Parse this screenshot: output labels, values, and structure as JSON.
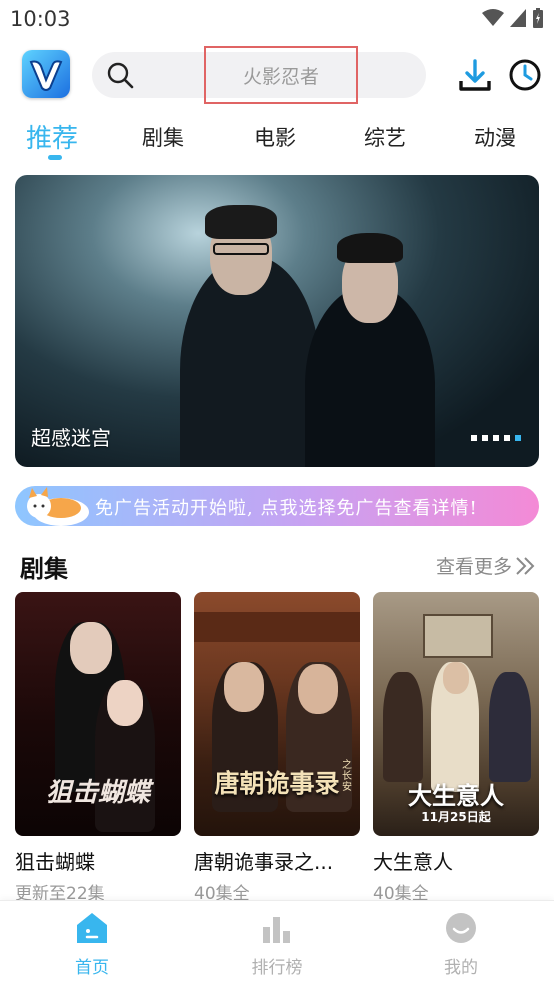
{
  "status_bar": {
    "time": "10:03"
  },
  "header": {
    "logo_letter": "V",
    "search_placeholder": "火影忍者"
  },
  "tabs": [
    {
      "label": "推荐",
      "active": true
    },
    {
      "label": "剧集",
      "active": false
    },
    {
      "label": "电影",
      "active": false
    },
    {
      "label": "综艺",
      "active": false
    },
    {
      "label": "动漫",
      "active": false
    }
  ],
  "banner": {
    "title": "超感迷宫",
    "dot_count": 5,
    "active_dot": 4
  },
  "promo": {
    "text": "免广告活动开始啦, 点我选择免广告查看详情!"
  },
  "section": {
    "title": "剧集",
    "more_label": "查看更多"
  },
  "cards": [
    {
      "title": "狙击蝴蝶",
      "subtitle": "更新至22集",
      "poster_text": "狙击蝴蝶"
    },
    {
      "title": "唐朝诡事录之...",
      "subtitle": "40集全",
      "poster_text": "唐朝诡事录",
      "poster_subtext": "之长安"
    },
    {
      "title": "大生意人",
      "subtitle": "40集全",
      "poster_text": "大生意人",
      "poster_date": "11月25日起"
    }
  ],
  "bottom_nav": [
    {
      "label": "首页",
      "icon": "home-icon",
      "active": true
    },
    {
      "label": "排行榜",
      "icon": "ranking-icon",
      "active": false
    },
    {
      "label": "我的",
      "icon": "profile-icon",
      "active": false
    }
  ],
  "colors": {
    "accent": "#38b6ee",
    "search_highlight_border": "#e06464"
  }
}
